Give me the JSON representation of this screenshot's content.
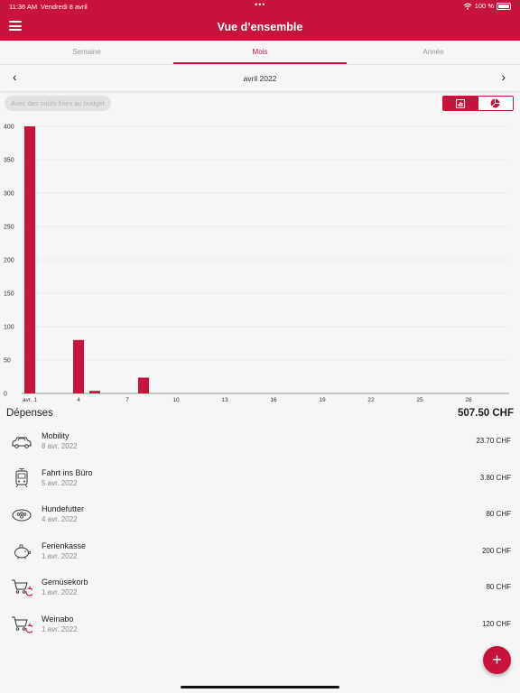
{
  "status": {
    "time": "11:36 AM",
    "date": "Vendredi 8 avril",
    "battery": "100 %"
  },
  "header": {
    "title": "Vue d’ensemble",
    "menu_icon": "hamburger-icon"
  },
  "tabs": [
    {
      "label": "Semaine",
      "active": false
    },
    {
      "label": "Mois",
      "active": true
    },
    {
      "label": "Année",
      "active": false
    }
  ],
  "period": {
    "label": "avril 2022"
  },
  "filter": {
    "label": "Avec des coûts fixes au budget"
  },
  "view_toggle": {
    "options": [
      "bar-chart-icon",
      "pie-chart-icon"
    ],
    "selected": "bar-chart-icon"
  },
  "accent": "#c8143c",
  "chart_data": {
    "type": "bar",
    "x_ticks": [
      "avr. 1",
      "4",
      "7",
      "10",
      "13",
      "16",
      "19",
      "22",
      "25",
      "28"
    ],
    "y_ticks": [
      "0",
      "50",
      "100",
      "150",
      "200",
      "250",
      "300",
      "350",
      "400"
    ],
    "ylim": [
      0,
      400
    ],
    "days": [
      1,
      4,
      5,
      8
    ],
    "values": [
      400,
      80,
      3.8,
      23.7
    ]
  },
  "expenses": {
    "label": "Dépenses",
    "total": "507.50 CHF",
    "items": [
      {
        "name": "Mobility",
        "date": "8 avr. 2022",
        "amount": "23.70 CHF",
        "icon": "car-icon"
      },
      {
        "name": "Fahrt ins Büro",
        "date": "5 avr. 2022",
        "amount": "3.80 CHF",
        "icon": "tram-icon"
      },
      {
        "name": "Hundefutter",
        "date": "4 avr. 2022",
        "amount": "80 CHF",
        "icon": "pet-icon"
      },
      {
        "name": "Ferienkasse",
        "date": "1 avr. 2022",
        "amount": "200 CHF",
        "icon": "piggy-bank-icon"
      },
      {
        "name": "Gemüsekorb",
        "date": "1 avr. 2022",
        "amount": "80 CHF",
        "icon": "recurring-cart-icon"
      },
      {
        "name": "Weinabo",
        "date": "1 avr. 2022",
        "amount": "120 CHF",
        "icon": "recurring-cart-icon"
      }
    ]
  },
  "fab": {
    "label": "+"
  }
}
